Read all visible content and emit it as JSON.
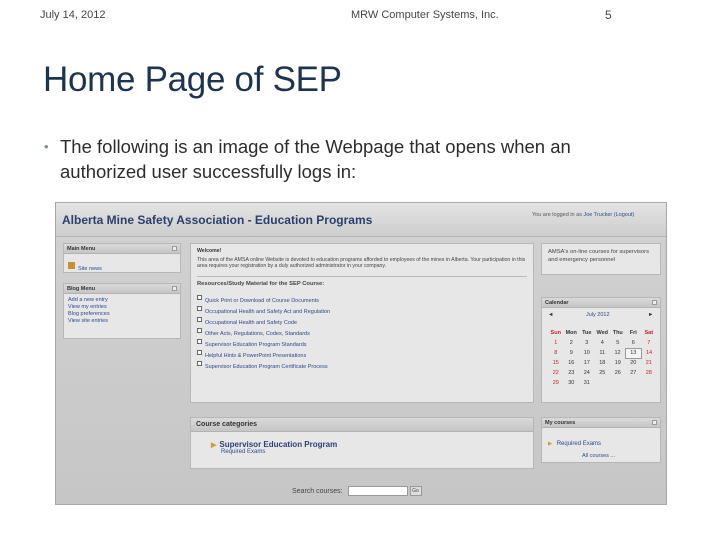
{
  "slide": {
    "date": "July 14, 2012",
    "company": "MRW Computer Systems, Inc.",
    "page_number": "5",
    "title": "Home Page of SEP",
    "bullet": "The following is an image of the Webpage that opens when an authorized user successfully logs in:"
  },
  "site": {
    "title": "Alberta Mine Safety Association - Education Programs",
    "login_prefix": "You are logged in as",
    "login_user": "Joe Trucker",
    "login_action": "(Logout)"
  },
  "main_menu": {
    "title": "Main Menu",
    "items": [
      "Site news"
    ]
  },
  "blog_menu": {
    "title": "Blog Menu",
    "items": [
      "Add a new entry",
      "View my entries",
      "Blog preferences",
      "View site entries"
    ]
  },
  "welcome": {
    "heading": "Welcome!",
    "body": "This area of the AMSA online Website is devoted to education programs afforded to employees of the mines in Alberta. Your participation in this area requires your registration by a duly authorized administrator in your company."
  },
  "resources": {
    "heading": "Resources/Study Material for the SEP Course:",
    "items": [
      "Quick Print or Download of Course Documents",
      "Occupational Health and Safety Act and Regulation",
      "Occupational Health and Safety Code",
      "Other Acts, Regulations, Codes, Standards",
      "Supervisor Education Program Standards",
      "Helpful Hints & PowerPoint Presentations",
      "Supervisor Education Program Certificate Process"
    ]
  },
  "course_categories": {
    "title": "Course categories",
    "category": "Supervisor Education Program",
    "sub": "Required Exams"
  },
  "search": {
    "label": "Search courses:",
    "button": "Go"
  },
  "info_box": {
    "text": "AMSA's on-line courses for supervisors and emergency personnel"
  },
  "calendar": {
    "title": "Calendar",
    "month": "July 2012",
    "prev": "◄",
    "next": "►",
    "days": [
      "Sun",
      "Mon",
      "Tue",
      "Wed",
      "Thu",
      "Fri",
      "Sat"
    ],
    "weeks": [
      [
        "1",
        "2",
        "3",
        "4",
        "5",
        "6",
        "7"
      ],
      [
        "8",
        "9",
        "10",
        "11",
        "12",
        "13",
        "14"
      ],
      [
        "15",
        "16",
        "17",
        "18",
        "19",
        "20",
        "21"
      ],
      [
        "22",
        "23",
        "24",
        "25",
        "26",
        "27",
        "28"
      ],
      [
        "29",
        "30",
        "31",
        "",
        "",
        "",
        ""
      ]
    ],
    "today": "13"
  },
  "my_courses": {
    "title": "My courses",
    "items": [
      "Required Exams"
    ],
    "all_link": "All courses ..."
  }
}
